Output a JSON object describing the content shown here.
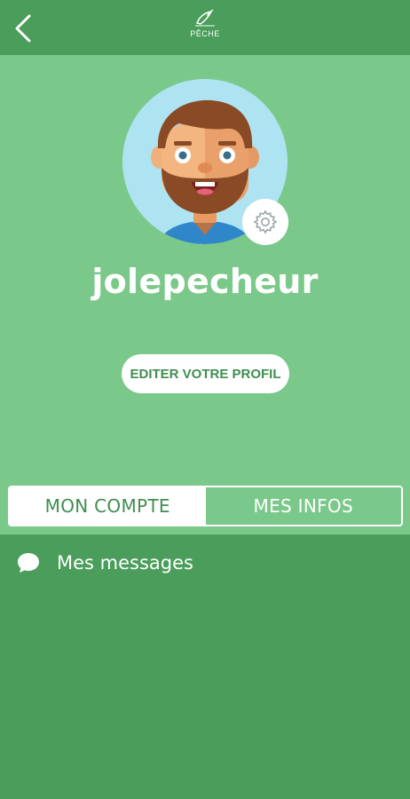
{
  "header": {
    "back_icon": "chevron-left-icon",
    "logo_text": "PÊCHE",
    "logo_icon": "fish-logo-icon"
  },
  "profile": {
    "avatar_icon": "bearded-man-avatar",
    "settings_icon": "gear-icon",
    "username": "jolepecheur",
    "edit_button_label": "EDITER VOTRE PROFIL"
  },
  "tabs": [
    {
      "label": "MON COMPTE",
      "active": true
    },
    {
      "label": "MES INFOS",
      "active": false
    }
  ],
  "menu": {
    "items": [
      {
        "label": "Mes messages",
        "icon": "chat-bubble-icon"
      }
    ]
  },
  "colors": {
    "header_bg": "#4a9d5a",
    "profile_bg": "#7bc98a",
    "content_bg": "#4a9d5a",
    "accent_text": "#3f8e51",
    "avatar_bg": "#aee4f2"
  }
}
